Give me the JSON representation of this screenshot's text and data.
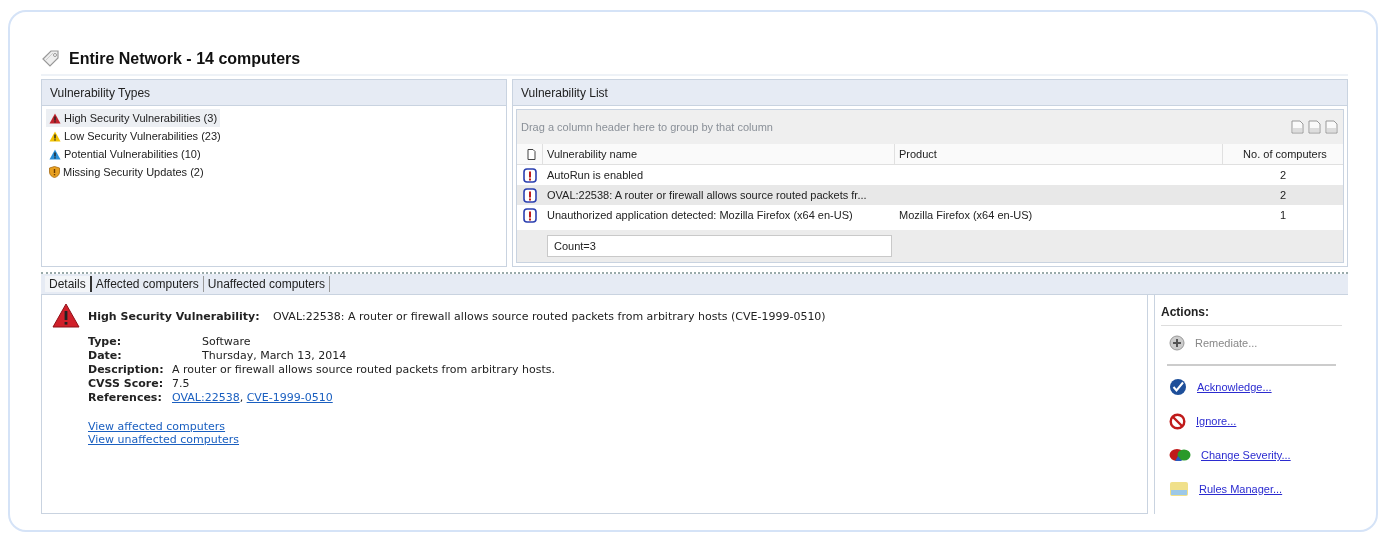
{
  "header": {
    "title": "Entire Network - 14 computers"
  },
  "vulnerability_types": {
    "title": "Vulnerability Types",
    "items": [
      {
        "label": "High Security Vulnerabilities (3)",
        "kind": "high",
        "selected": true
      },
      {
        "label": "Low Security Vulnerabilities (23)",
        "kind": "low",
        "selected": false
      },
      {
        "label": "Potential Vulnerabilities (10)",
        "kind": "potential",
        "selected": false
      },
      {
        "label": "Missing Security Updates (2)",
        "kind": "updates",
        "selected": false
      }
    ]
  },
  "vulnerability_list": {
    "title": "Vulnerability List",
    "group_placeholder": "Drag a column header here to group by that column",
    "columns": [
      "Vulnerability name",
      "Product",
      "No. of computers"
    ],
    "rows": [
      {
        "name": "AutoRun is enabled",
        "computers": "2",
        "selected": false
      },
      {
        "name": "OVAL:22538: A router or firewall allows source routed packets fr...",
        "computers": "2",
        "selected": true
      },
      {
        "name": "Unauthorized application detected: Mozilla Firefox (x64 en-US)",
        "product": "Mozilla Firefox (x64 en-US)",
        "computers": "1",
        "selected": false
      }
    ],
    "footer": "Count=3"
  },
  "details": {
    "tabs": [
      {
        "label": "Details",
        "selected": true
      },
      {
        "label": "Affected computers",
        "selected": false
      },
      {
        "label": "Unaffected computers",
        "selected": false
      }
    ],
    "heading_label": "High Security Vulnerability:",
    "heading_text": "OVAL:22538: A router or firewall allows source routed packets from arbitrary hosts (CVE-1999-0510)",
    "fields": [
      {
        "label": "Type:",
        "value": "Software"
      },
      {
        "label": "Date:",
        "value": "Thursday, March 13, 2014"
      },
      {
        "label": "Description:",
        "value": "A router or firewall allows source routed packets from arbitrary hosts."
      },
      {
        "label": "CVSS Score:",
        "value": "7.5"
      },
      {
        "label": "References:",
        "links": [
          "OVAL:22538",
          "CVE-1999-0510"
        ],
        "separator": ", "
      }
    ],
    "links": [
      "View affected computers",
      "View unaffected computers"
    ]
  },
  "actions": {
    "title": "Actions:",
    "items": [
      {
        "label": "Remediate...",
        "kind": "remediate",
        "disabled": true
      },
      {
        "label": "Acknowledge...",
        "kind": "acknowledge",
        "disabled": false
      },
      {
        "label": "Ignore...",
        "kind": "ignore",
        "disabled": false
      },
      {
        "label": "Change Severity...",
        "kind": "severity",
        "disabled": false
      },
      {
        "label": "Rules Manager...",
        "kind": "rules",
        "disabled": false
      }
    ]
  }
}
